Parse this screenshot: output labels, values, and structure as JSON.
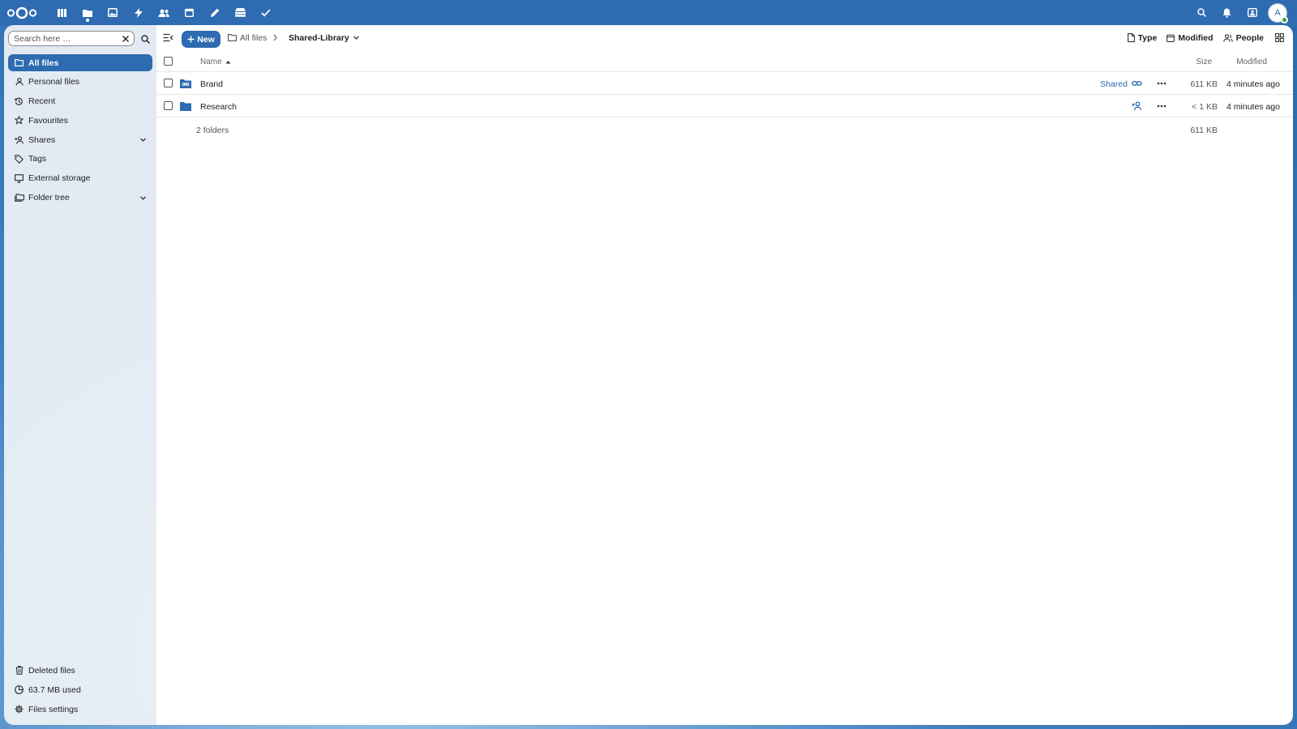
{
  "topbar": {
    "logo": "nextcloud-logo",
    "apps": [
      {
        "name": "dashboard-icon"
      },
      {
        "name": "files-icon",
        "active": true
      },
      {
        "name": "photos-icon"
      },
      {
        "name": "activity-icon"
      },
      {
        "name": "contacts-icon"
      },
      {
        "name": "calendar-icon"
      },
      {
        "name": "notes-icon"
      },
      {
        "name": "deck-icon"
      },
      {
        "name": "tasks-icon"
      }
    ],
    "avatar_letter": "A"
  },
  "sidebar": {
    "search_placeholder": "Search here …",
    "items": [
      {
        "label": "All files",
        "icon": "folder-icon",
        "active": true
      },
      {
        "label": "Personal files",
        "icon": "user-icon"
      },
      {
        "label": "Recent",
        "icon": "history-icon"
      },
      {
        "label": "Favourites",
        "icon": "star-icon"
      },
      {
        "label": "Shares",
        "icon": "share-icon",
        "expandable": true
      },
      {
        "label": "Tags",
        "icon": "tag-icon"
      },
      {
        "label": "External storage",
        "icon": "monitor-icon"
      },
      {
        "label": "Folder tree",
        "icon": "folder-tree-icon",
        "expandable": true
      }
    ],
    "bottom": [
      {
        "label": "Deleted files",
        "icon": "trash-icon"
      },
      {
        "label": "63.7 MB used",
        "icon": "storage-icon"
      },
      {
        "label": "Files settings",
        "icon": "gear-icon"
      }
    ]
  },
  "toolbar": {
    "new_label": "New",
    "breadcrumb_root": "All files",
    "breadcrumb_current": "Shared-Library",
    "filter_type": "Type",
    "filter_modified": "Modified",
    "filter_people": "People"
  },
  "table": {
    "headers": {
      "name": "Name",
      "size": "Size",
      "modified": "Modified"
    },
    "rows": [
      {
        "name": "Brand",
        "share_label": "Shared",
        "share_icon": "link-icon",
        "size": "611 KB",
        "modified": "4 minutes ago"
      },
      {
        "name": "Research",
        "share_label": "",
        "share_icon": "add-user-icon",
        "size": "< 1 KB",
        "modified": "4 minutes ago"
      }
    ],
    "footer": {
      "count": "2 folders",
      "total": "611 KB"
    }
  },
  "colors": {
    "accent": "#2e6bb0",
    "topbar": "#2e6bb0"
  }
}
